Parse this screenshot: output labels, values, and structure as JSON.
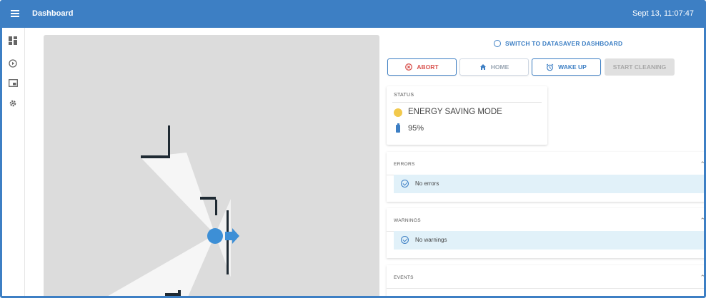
{
  "topbar": {
    "title": "Dashboard",
    "datetime": "Sept 13, 11:07:47"
  },
  "rail": {
    "items": [
      {
        "icon": "dashboard-grid-icon"
      },
      {
        "icon": "play-circle-icon"
      },
      {
        "icon": "picture-in-picture-icon"
      },
      {
        "icon": "gear-icon"
      }
    ]
  },
  "controls": {
    "switch_link": "SWITCH TO DATASAVER DASHBOARD",
    "abort_label": "ABORT",
    "home_label": "HOME",
    "wake_label": "WAKE UP",
    "start_label": "START CLEANING"
  },
  "status": {
    "label": "STATUS",
    "mode": "ENERGY SAVING MODE",
    "battery": "95%",
    "mode_color": "#f2c94c"
  },
  "errors": {
    "title": "ERRORS",
    "message": "No errors"
  },
  "warnings": {
    "title": "WARNINGS",
    "message": "No warnings"
  },
  "events": {
    "title": "EVENTS"
  },
  "colors": {
    "accent": "#3d7fc4",
    "abort": "#d9534f",
    "info_bg": "#e1f1f9"
  }
}
